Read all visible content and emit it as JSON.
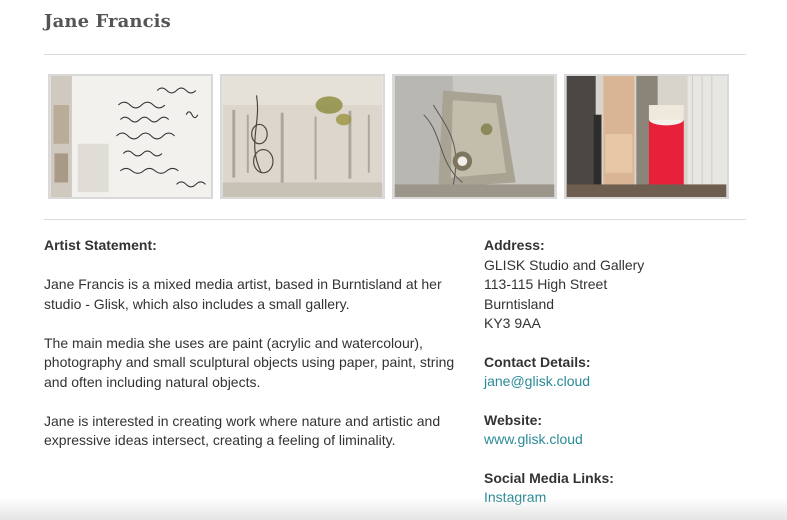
{
  "artist": {
    "name": "Jane Francis"
  },
  "gallery": {
    "images": [
      {
        "name": "studio-writing-wall-photo"
      },
      {
        "name": "ink-watercolour-painting-photo"
      },
      {
        "name": "paper-sculpture-photo"
      },
      {
        "name": "paint-rolls-photo"
      }
    ]
  },
  "statement": {
    "heading": "Artist Statement:",
    "paragraphs": [
      "Jane Francis is a mixed media artist, based in Burntisland at her studio - Glisk, which also includes a small gallery.",
      "The main media she uses are paint (acrylic and watercolour), photography and small sculptural objects using paper, paint, string and often including natural objects.",
      "Jane is interested in creating work where nature and artistic and expressive ideas intersect, creating a feeling of liminality."
    ]
  },
  "address": {
    "label": "Address:",
    "lines": [
      "GLISK Studio and Gallery",
      "113-115 High Street",
      "Burntisland",
      "KY3 9AA"
    ]
  },
  "contact": {
    "label": "Contact Details:",
    "email": "jane@glisk.cloud"
  },
  "website": {
    "label": "Website:",
    "url": "www.glisk.cloud"
  },
  "social": {
    "label": "Social Media Links:",
    "instagram": "Instagram"
  },
  "colors": {
    "link": "#2a8a96",
    "heading": "#555555",
    "body_text": "#333333"
  }
}
